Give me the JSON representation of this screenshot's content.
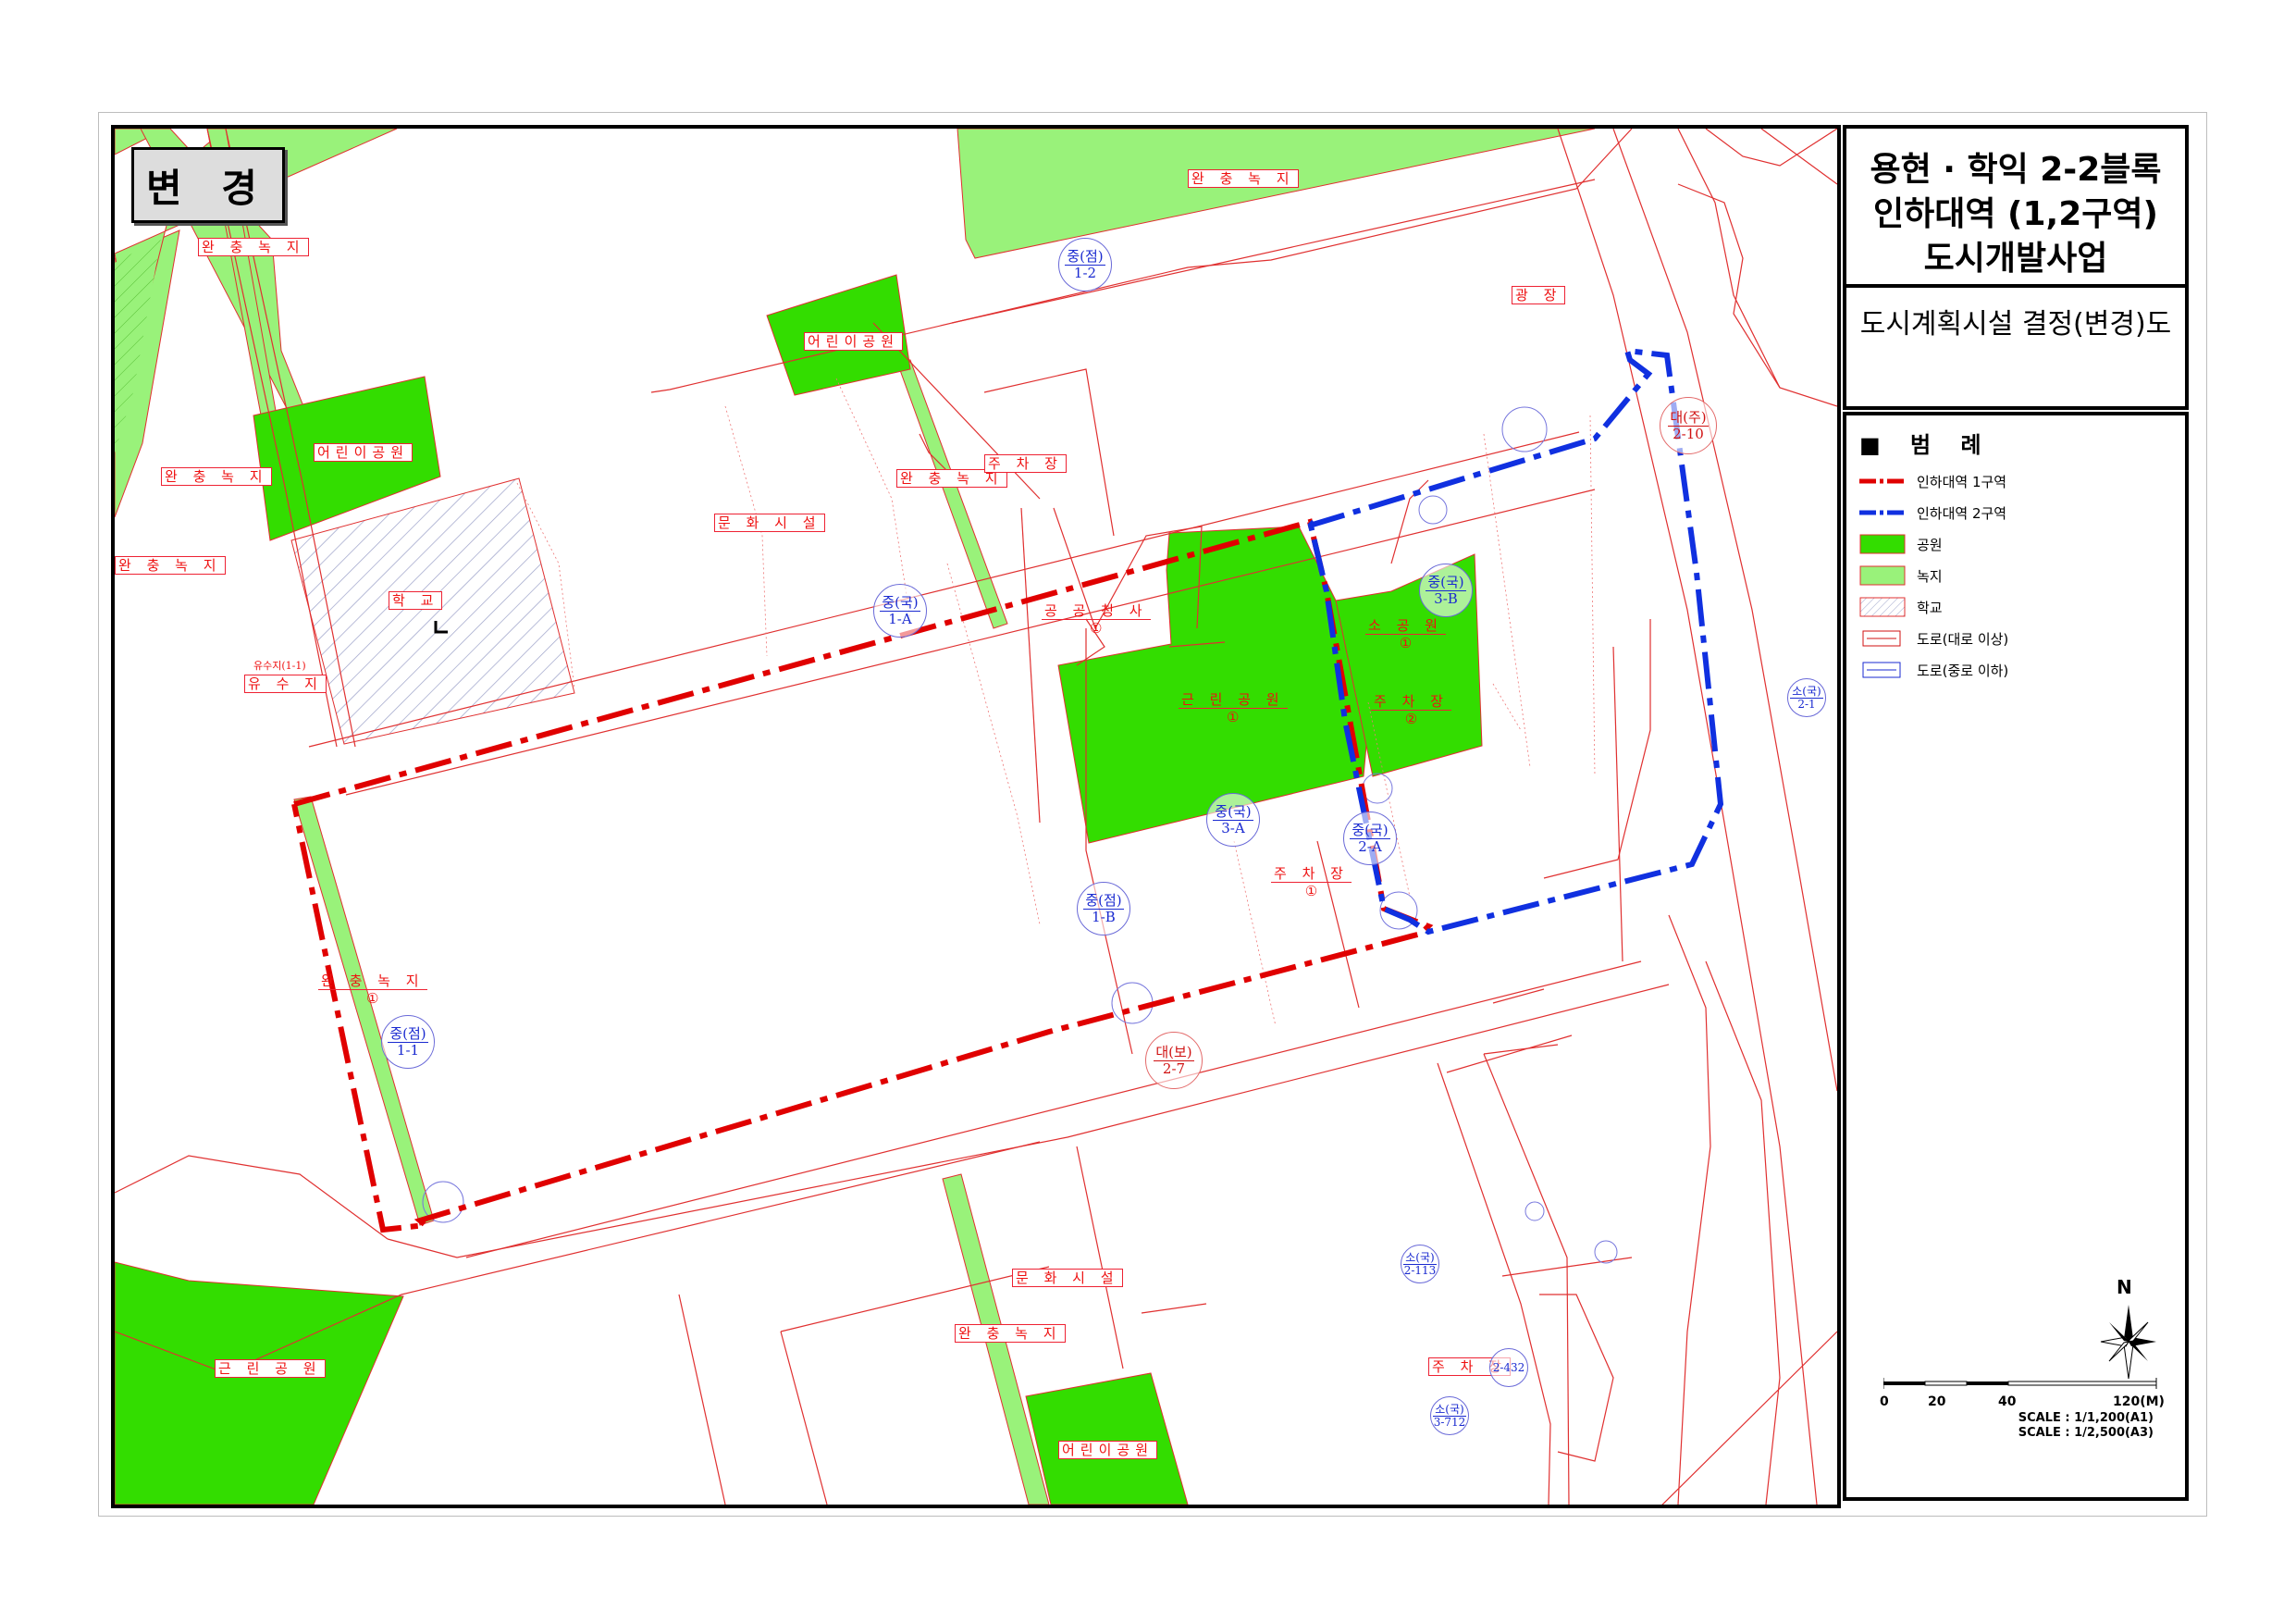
{
  "stamp": "변 경",
  "title": {
    "line1": "용현 · 학익 2-2블록",
    "line2": "인하대역 (1,2구역)",
    "line3": "도시개발사업",
    "subtitle": "도시계획시설 결정(변경)도"
  },
  "legend": {
    "heading": "범 례",
    "items": [
      {
        "label": "인하대역 1구역",
        "kind": "line-red"
      },
      {
        "label": "인하대역 2구역",
        "kind": "line-blue"
      },
      {
        "label": "공원",
        "kind": "fill",
        "color": "#33dd00"
      },
      {
        "label": "녹지",
        "kind": "fill",
        "color": "#99f27a"
      },
      {
        "label": "학교",
        "kind": "hatch"
      },
      {
        "label": "도로(대로 이상)",
        "kind": "road-red"
      },
      {
        "label": "도로(중로 이하)",
        "kind": "road-blue"
      }
    ]
  },
  "scale": {
    "ticks": [
      "0",
      "20",
      "40",
      "120(M)"
    ],
    "line1": "SCALE : 1/1,200(A1)",
    "line2": "SCALE : 1/2,500(A3)"
  },
  "north": "N",
  "labels": {
    "buffer_green": "완 충 녹 지",
    "kids_park": "어린이공원",
    "culture": "문 화 시 설",
    "school": "학   교",
    "parking": "주   차   장",
    "public_office": "공 공 청 사",
    "neighborhood_park": "근 린 공 원",
    "small_park": "소 공 원",
    "plaza": "광   장",
    "retention": "유 수 지",
    "retention_small": "유수지(1-1)",
    "num1": "①",
    "num2": "②"
  },
  "roads": [
    {
      "top": "중(점)",
      "bottom": "1-2",
      "color": "blue"
    },
    {
      "top": "중(국)",
      "bottom": "1-A",
      "color": "blue"
    },
    {
      "top": "중(국)",
      "bottom": "3-B",
      "color": "blue"
    },
    {
      "top": "중(국)",
      "bottom": "3-A",
      "color": "blue"
    },
    {
      "top": "중(국)",
      "bottom": "2-A",
      "color": "blue"
    },
    {
      "top": "중(점)",
      "bottom": "1-B",
      "color": "blue"
    },
    {
      "top": "중(점)",
      "bottom": "1-1",
      "color": "blue"
    },
    {
      "top": "대(보)",
      "bottom": "2-7",
      "color": "red"
    },
    {
      "top": "대(주)",
      "bottom": "2-10",
      "color": "red"
    },
    {
      "top": "소(국)",
      "bottom": "2-1",
      "color": "blue"
    },
    {
      "top": "소(국)",
      "bottom": "2-113",
      "color": "blue"
    },
    {
      "top": "소(국)",
      "bottom": "3-712",
      "color": "blue"
    },
    {
      "top": "",
      "bottom": "2-432",
      "color": "blue"
    }
  ],
  "colors": {
    "park": "#33dd00",
    "green": "#99f27a",
    "zone1": "#e00000",
    "zone2": "#1030e0",
    "lot": "#e03030"
  }
}
